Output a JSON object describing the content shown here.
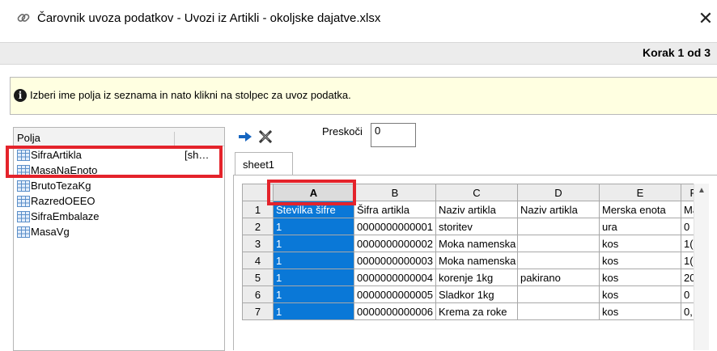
{
  "window": {
    "title": "Čarovnik uvoza podatkov - Uvozi iz Artikli - okoljske dajatve.xlsx",
    "close_glyph": "✕",
    "app_icon": "link-icon"
  },
  "step": {
    "label": "Korak 1 od 3"
  },
  "info": {
    "icon": "info-icon",
    "text": "Izberi ime polja iz seznama in nato klikni na stolpec za uvoz podatka."
  },
  "fields_panel": {
    "header_name": "Polja",
    "header_sheet": "",
    "items": [
      {
        "label": "SifraArtikla",
        "sheet": "[sh…"
      },
      {
        "label": "MasaNaEnoto",
        "sheet": ""
      },
      {
        "label": "BrutoTezaKg",
        "sheet": ""
      },
      {
        "label": "RazredOEEO",
        "sheet": ""
      },
      {
        "label": "SifraEmbalaze",
        "sheet": ""
      },
      {
        "label": "MasaVg",
        "sheet": ""
      }
    ]
  },
  "toolbar": {
    "assign_icon": "arrow-right-icon",
    "clear_icon": "clear-x-icon",
    "skip_label": "Preskoči",
    "skip_value": "0"
  },
  "sheet_tabs": [
    {
      "label": "sheet1"
    }
  ],
  "grid": {
    "selected_column": "A",
    "columns": [
      "A",
      "B",
      "C",
      "D",
      "E",
      "F"
    ],
    "rows": [
      {
        "num": "1",
        "cells": [
          "Številka šifre",
          "Šifra artikla",
          "Naziv artikla",
          "Naziv artikla",
          "Merska enota",
          "Ma"
        ]
      },
      {
        "num": "2",
        "cells": [
          "1",
          "0000000000001",
          "storitev",
          "",
          "ura",
          "0"
        ]
      },
      {
        "num": "3",
        "cells": [
          "1",
          "0000000000002",
          "Moka namenska",
          "",
          "kos",
          "1("
        ]
      },
      {
        "num": "4",
        "cells": [
          "1",
          "0000000000003",
          "Moka namenska",
          "",
          "kos",
          "1("
        ]
      },
      {
        "num": "5",
        "cells": [
          "1",
          "0000000000004",
          "korenje 1kg",
          "pakirano",
          "kos",
          "20"
        ]
      },
      {
        "num": "6",
        "cells": [
          "1",
          "0000000000005",
          "Sladkor 1kg",
          "",
          "kos",
          "0"
        ]
      },
      {
        "num": "7",
        "cells": [
          "1",
          "0000000000006",
          "Krema za roke",
          "",
          "kos",
          "0,"
        ]
      }
    ]
  },
  "colors": {
    "selection_blue": "#0a78d7",
    "highlight_red": "#e4232b",
    "info_bg": "#ffffe1"
  }
}
